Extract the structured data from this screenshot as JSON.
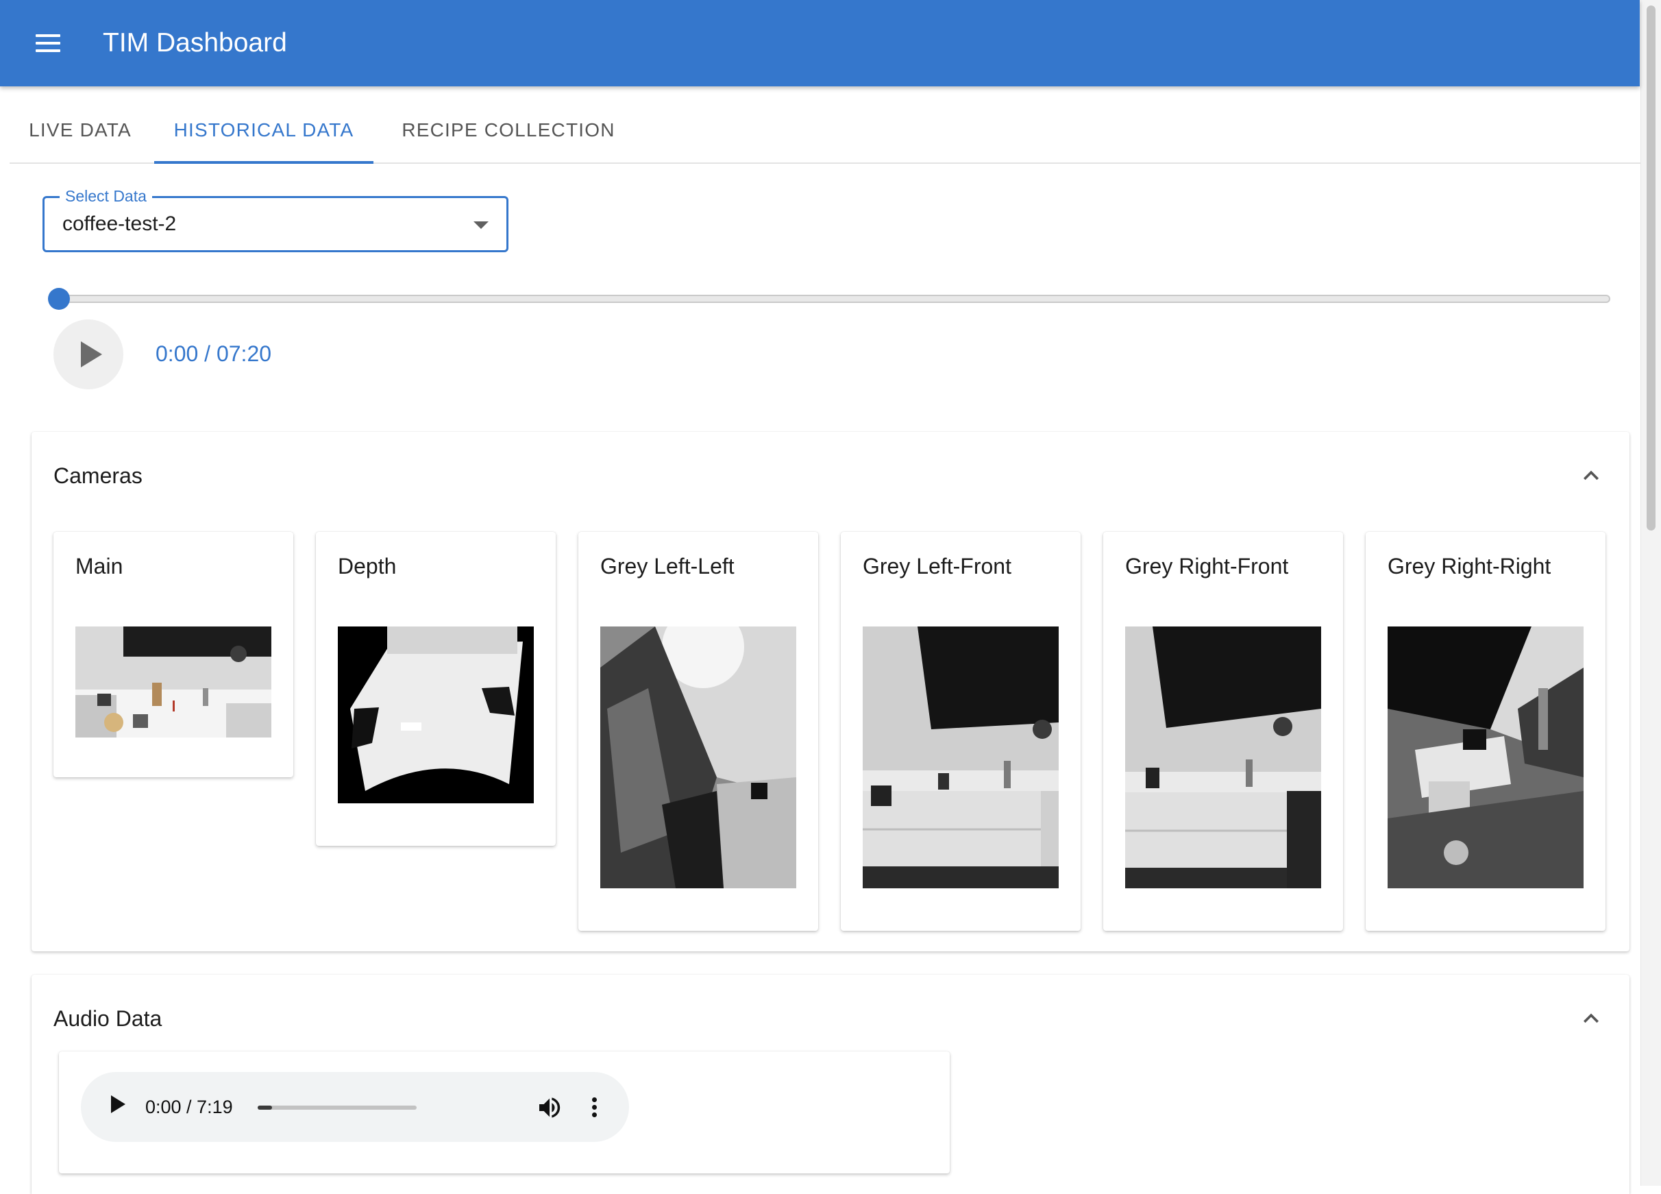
{
  "app": {
    "title": "TIM Dashboard"
  },
  "tabs": [
    {
      "label": "LIVE DATA",
      "active": false
    },
    {
      "label": "HISTORICAL DATA",
      "active": true
    },
    {
      "label": "RECIPE COLLECTION",
      "active": false
    }
  ],
  "select": {
    "label": "Select Data",
    "value": "coffee-test-2"
  },
  "playback": {
    "time": "0:00 / 07:20",
    "progress": 0
  },
  "cameras": {
    "title": "Cameras",
    "items": [
      {
        "label": "Main"
      },
      {
        "label": "Depth"
      },
      {
        "label": "Grey Left-Left"
      },
      {
        "label": "Grey Left-Front"
      },
      {
        "label": "Grey Right-Front"
      },
      {
        "label": "Grey Right-Right"
      }
    ]
  },
  "audio": {
    "title": "Audio Data",
    "time": "0:00 / 7:19",
    "progress": 0.09
  },
  "colors": {
    "primary": "#3577cc",
    "appbar_text": "#ffffff"
  },
  "icons": {
    "menu": "hamburger-menu-icon",
    "dropdown": "caret-down-icon",
    "play": "play-icon",
    "expand": "chevron-up-icon",
    "volume": "volume-icon",
    "more": "more-vert-icon"
  }
}
